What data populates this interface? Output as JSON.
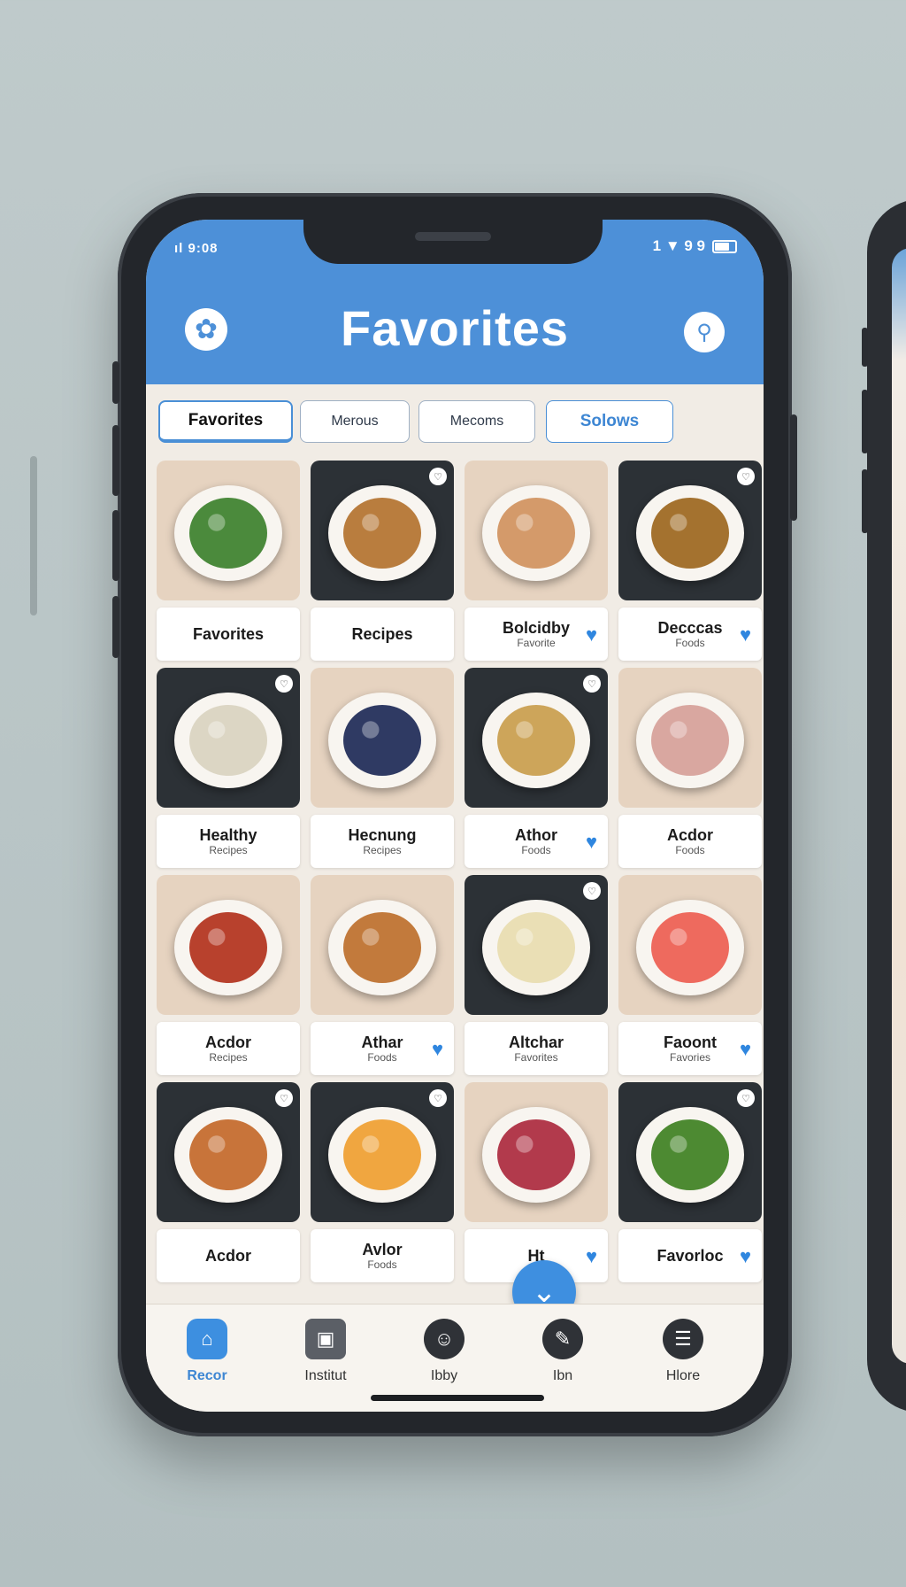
{
  "status_bar": {
    "left": "ıl 9:08",
    "right": "1 ▼ 9 9"
  },
  "header": {
    "title": "Favorites",
    "star_icon": "star-icon",
    "search_icon": "search-icon"
  },
  "tabs": [
    "Favorites",
    "Merous",
    "Mecoms",
    "Solows"
  ],
  "cards": [
    {
      "title": "Favorites",
      "subtitle": "",
      "theme": "light",
      "food": "#4b8a3c",
      "liked": false
    },
    {
      "title": "Recipes",
      "subtitle": "",
      "theme": "dark",
      "food": "#b97d3e",
      "liked": false
    },
    {
      "title": "Bolcidby",
      "subtitle": "Favorite",
      "theme": "light",
      "food": "#d49a6a",
      "liked": true
    },
    {
      "title": "Decccas",
      "subtitle": "Foods",
      "theme": "dark",
      "food": "#a4722f",
      "liked": true
    },
    {
      "title": "Healthy",
      "subtitle": "Recipes",
      "theme": "dark",
      "food": "#dcd6c4",
      "liked": false
    },
    {
      "title": "Hecnung",
      "subtitle": "Recipes",
      "theme": "light",
      "food": "#2f3a63",
      "liked": false
    },
    {
      "title": "Athor",
      "subtitle": "Foods",
      "theme": "dark",
      "food": "#cda55a",
      "liked": true
    },
    {
      "title": "Acdor",
      "subtitle": "Foods",
      "theme": "light",
      "food": "#d9a7a0",
      "liked": false
    },
    {
      "title": "Acdor",
      "subtitle": "Recipes",
      "theme": "light",
      "food": "#b8412d",
      "liked": false
    },
    {
      "title": "Athar",
      "subtitle": "Foods",
      "theme": "light",
      "food": "#c27a3c",
      "liked": true
    },
    {
      "title": "Altchar",
      "subtitle": "Favorites",
      "theme": "dark",
      "food": "#eadfb5",
      "liked": false
    },
    {
      "title": "Faoont",
      "subtitle": "Favories",
      "theme": "light",
      "food": "#ee6a5e",
      "liked": true
    },
    {
      "title": "Acdor",
      "subtitle": "",
      "theme": "dark",
      "food": "#c8743a",
      "liked": false
    },
    {
      "title": "Avlor",
      "subtitle": "Foods",
      "theme": "dark",
      "food": "#f0a640",
      "liked": false
    },
    {
      "title": "Ht",
      "subtitle": "",
      "theme": "light",
      "food": "#b23a4c",
      "liked": true
    },
    {
      "title": "Favorloc",
      "subtitle": "",
      "theme": "dark",
      "food": "#4d8a32",
      "liked": true
    }
  ],
  "fab_icon": "chevron-down-icon",
  "bottom_nav": [
    {
      "label": "Recor",
      "icon": "home-icon"
    },
    {
      "label": "Institut",
      "icon": "book-icon"
    },
    {
      "label": "Ibby",
      "icon": "profile-icon"
    },
    {
      "label": "Ibn",
      "icon": "chat-icon"
    },
    {
      "label": "Hlore",
      "icon": "menu-icon"
    }
  ]
}
